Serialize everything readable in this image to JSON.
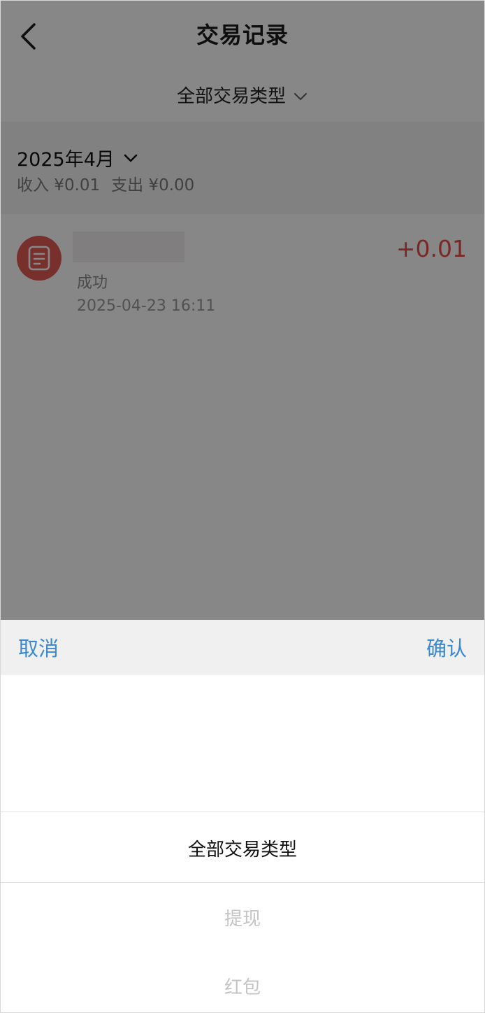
{
  "nav": {
    "title": "交易记录",
    "back_icon": "chevron-left-icon"
  },
  "filter": {
    "label": "全部交易类型",
    "icon": "chevron-down-icon"
  },
  "month_bar": {
    "month": "2025年4月",
    "income": "收入 ¥0.01",
    "expense": "支出 ¥0.00"
  },
  "transactions": [
    {
      "icon": "document-icon",
      "status": "成功",
      "time": "2025-04-23 16:11",
      "amount": "+0.01"
    }
  ],
  "sheet": {
    "cancel_label": "取消",
    "confirm_label": "确认",
    "options": [
      "全部交易类型",
      "提现",
      "红包"
    ],
    "selected": "全部交易类型"
  },
  "colors": {
    "accent": "#3a88cf",
    "income_red": "#ea4a44",
    "icon_red": "#e25b55"
  }
}
